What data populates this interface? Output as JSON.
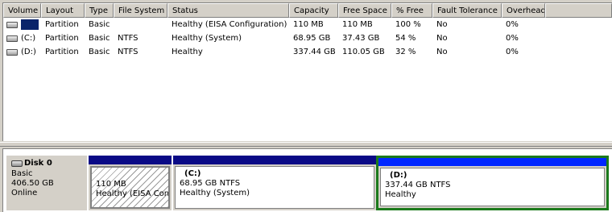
{
  "volume_list": {
    "columns": [
      "Volume",
      "Layout",
      "Type",
      "File System",
      "Status",
      "Capacity",
      "Free Space",
      "% Free",
      "Fault Tolerance",
      "Overhead"
    ],
    "rows": [
      {
        "volume": "",
        "layout": "Partition",
        "type": "Basic",
        "file_system": "",
        "status": "Healthy (EISA Configuration)",
        "capacity": "110 MB",
        "free_space": "110 MB",
        "pct_free": "100 %",
        "fault_tolerance": "No",
        "overhead": "0%",
        "selected": true
      },
      {
        "volume": "(C:)",
        "layout": "Partition",
        "type": "Basic",
        "file_system": "NTFS",
        "status": "Healthy (System)",
        "capacity": "68.95 GB",
        "free_space": "37.43 GB",
        "pct_free": "54 %",
        "fault_tolerance": "No",
        "overhead": "0%",
        "selected": false
      },
      {
        "volume": "(D:)",
        "layout": "Partition",
        "type": "Basic",
        "file_system": "NTFS",
        "status": "Healthy",
        "capacity": "337.44 GB",
        "free_space": "110.05 GB",
        "pct_free": "32 %",
        "fault_tolerance": "No",
        "overhead": "0%",
        "selected": false
      }
    ]
  },
  "disk_map": {
    "disk": {
      "name": "Disk 0",
      "type": "Basic",
      "size": "406.50 GB",
      "status": "Online"
    },
    "partitions": [
      {
        "drive": "",
        "size": "110 MB",
        "status": "Healthy (EISA Conf",
        "hatched": true
      },
      {
        "drive": "(C:)",
        "size": "68.95 GB NTFS",
        "status": "Healthy (System)",
        "hatched": false
      },
      {
        "drive": "(D:)",
        "size": "337.44 GB NTFS",
        "status": "Healthy",
        "hatched": false,
        "selected": true
      }
    ]
  },
  "colors": {
    "bar": "#0a0a86",
    "bar_selected": "#0026ff",
    "selection_outline": "#1c7a1c",
    "row_highlight": "#0a246a"
  }
}
